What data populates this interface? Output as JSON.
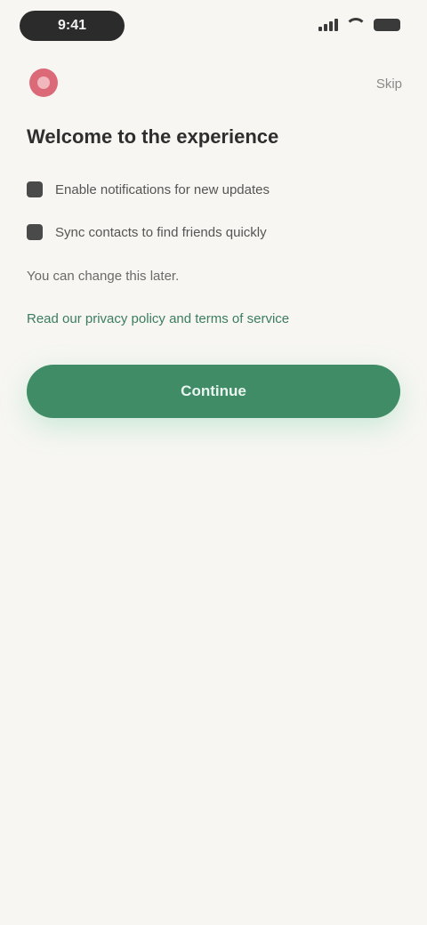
{
  "status_bar": {
    "time": "9:41"
  },
  "header": {
    "action_label": "Skip"
  },
  "content": {
    "title": "Welcome to the experience",
    "options": [
      {
        "label": "Enable notifications for new updates"
      },
      {
        "label": "Sync contacts to find friends quickly"
      }
    ],
    "note": "You can change this later.",
    "link_text": "Read our privacy policy and terms of service"
  },
  "primary_button": {
    "label": "Continue"
  },
  "colors": {
    "background": "#f7f6f2",
    "accent": "#3f8c67",
    "logo": "#d85a6a"
  }
}
